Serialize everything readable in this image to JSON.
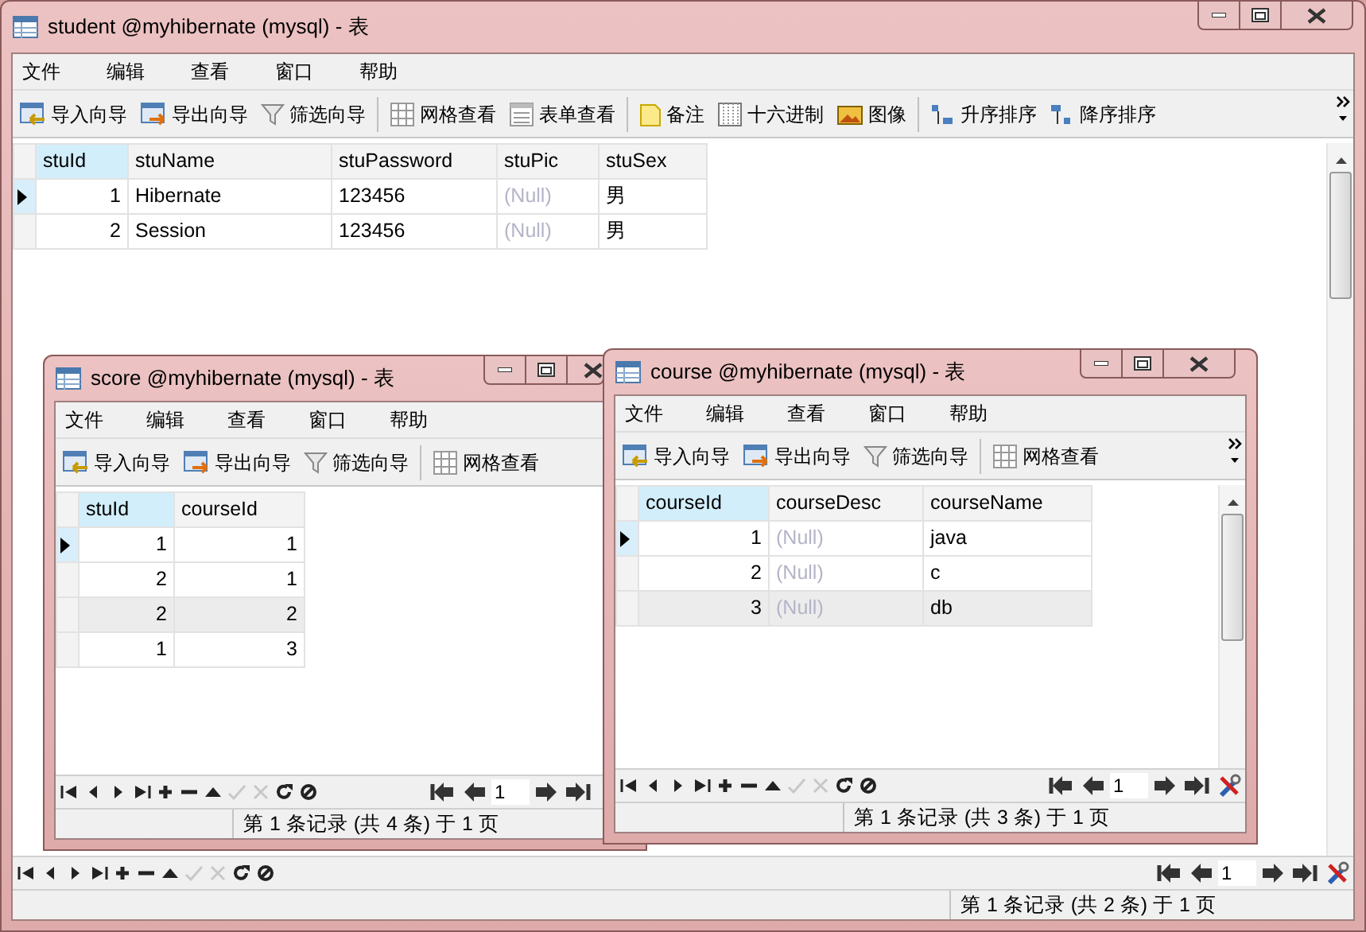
{
  "windows": [
    {
      "title": "student @myhibernate (mysql) - 表",
      "menu": [
        "文件",
        "编辑",
        "查看",
        "窗口",
        "帮助"
      ],
      "toolbar_groups": [
        {
          "items": [
            {
              "label": "导入向导",
              "kind": "import"
            },
            {
              "label": "导出向导",
              "kind": "export"
            },
            {
              "label": "筛选向导",
              "kind": "filter"
            }
          ]
        },
        {
          "items": [
            {
              "label": "网格查看",
              "kind": "grid"
            },
            {
              "label": "表单查看",
              "kind": "form"
            }
          ]
        },
        {
          "items": [
            {
              "label": "备注",
              "kind": "memo"
            },
            {
              "label": "十六进制",
              "kind": "hex"
            },
            {
              "label": "图像",
              "kind": "image"
            }
          ]
        },
        {
          "items": [
            {
              "label": "升序排序",
              "kind": "sort-asc"
            },
            {
              "label": "降序排序",
              "kind": "sort-desc"
            }
          ]
        }
      ],
      "toolbar_overflow": true,
      "columns": [
        {
          "label": "stuId",
          "kind": "number"
        },
        {
          "label": "stuName",
          "kind": "text"
        },
        {
          "label": "stuPassword",
          "kind": "text"
        },
        {
          "label": "stuPic",
          "kind": "text"
        },
        {
          "label": "stuSex",
          "kind": "text"
        }
      ],
      "rows": [
        {
          "selected": true,
          "highlighted": false,
          "cells": [
            {
              "text": "1",
              "is_null": false
            },
            {
              "text": "Hibernate",
              "is_null": false
            },
            {
              "text": "123456",
              "is_null": false
            },
            {
              "text": "(Null)",
              "is_null": true
            },
            {
              "text": "男",
              "is_null": false
            }
          ]
        },
        {
          "selected": false,
          "highlighted": false,
          "cells": [
            {
              "text": "2",
              "is_null": false
            },
            {
              "text": "Session",
              "is_null": false
            },
            {
              "text": "123456",
              "is_null": false
            },
            {
              "text": "(Null)",
              "is_null": true
            },
            {
              "text": "男",
              "is_null": false
            }
          ]
        }
      ],
      "nav": {
        "apply_disabled": true,
        "cancel_disabled": true
      },
      "page_field": "1",
      "status": "第 1 条记录 (共 2 条) 于 1 页"
    },
    {
      "title": "score @myhibernate (mysql) - 表",
      "menu": [
        "文件",
        "编辑",
        "查看",
        "窗口",
        "帮助"
      ],
      "toolbar_groups": [
        {
          "items": [
            {
              "label": "导入向导",
              "kind": "import"
            },
            {
              "label": "导出向导",
              "kind": "export"
            },
            {
              "label": "筛选向导",
              "kind": "filter"
            }
          ]
        },
        {
          "items": [
            {
              "label": "网格查看",
              "kind": "grid"
            }
          ]
        }
      ],
      "columns": [
        {
          "label": "stuId",
          "kind": "number"
        },
        {
          "label": "courseId",
          "kind": "number"
        }
      ],
      "rows": [
        {
          "selected": true,
          "highlighted": false,
          "cells": [
            {
              "text": "1",
              "is_null": false
            },
            {
              "text": "1",
              "is_null": false
            }
          ]
        },
        {
          "selected": false,
          "highlighted": false,
          "cells": [
            {
              "text": "2",
              "is_null": false
            },
            {
              "text": "1",
              "is_null": false
            }
          ]
        },
        {
          "selected": false,
          "highlighted": true,
          "cells": [
            {
              "text": "2",
              "is_null": false
            },
            {
              "text": "2",
              "is_null": false
            }
          ]
        },
        {
          "selected": false,
          "highlighted": false,
          "cells": [
            {
              "text": "1",
              "is_null": false
            },
            {
              "text": "3",
              "is_null": false
            }
          ]
        }
      ],
      "nav": {
        "apply_disabled": true,
        "cancel_disabled": true
      },
      "page_field": "1",
      "status": "第 1 条记录 (共 4 条) 于 1 页"
    },
    {
      "title": "course @myhibernate (mysql) - 表",
      "menu": [
        "文件",
        "编辑",
        "查看",
        "窗口",
        "帮助"
      ],
      "toolbar_groups": [
        {
          "items": [
            {
              "label": "导入向导",
              "kind": "import"
            },
            {
              "label": "导出向导",
              "kind": "export"
            },
            {
              "label": "筛选向导",
              "kind": "filter"
            }
          ]
        },
        {
          "items": [
            {
              "label": "网格查看",
              "kind": "grid"
            }
          ]
        }
      ],
      "toolbar_overflow": true,
      "columns": [
        {
          "label": "courseId",
          "kind": "number"
        },
        {
          "label": "courseDesc",
          "kind": "text"
        },
        {
          "label": "courseName",
          "kind": "text"
        }
      ],
      "rows": [
        {
          "selected": true,
          "highlighted": false,
          "cells": [
            {
              "text": "1",
              "is_null": false
            },
            {
              "text": "(Null)",
              "is_null": true
            },
            {
              "text": "java",
              "is_null": false
            }
          ]
        },
        {
          "selected": false,
          "highlighted": false,
          "cells": [
            {
              "text": "2",
              "is_null": false
            },
            {
              "text": "(Null)",
              "is_null": true
            },
            {
              "text": "c",
              "is_null": false
            }
          ]
        },
        {
          "selected": false,
          "highlighted": true,
          "cells": [
            {
              "text": "3",
              "is_null": false
            },
            {
              "text": "(Null)",
              "is_null": true
            },
            {
              "text": "db",
              "is_null": false
            }
          ]
        }
      ],
      "nav": {
        "apply_disabled": true,
        "cancel_disabled": true
      },
      "page_field": "1",
      "status": "第 1 条记录 (共 3 条) 于 1 页"
    }
  ]
}
